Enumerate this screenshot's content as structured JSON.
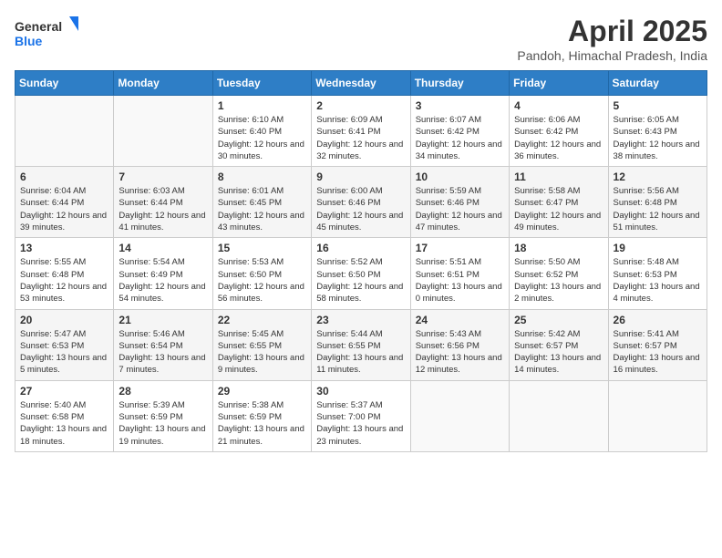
{
  "logo": {
    "line1": "General",
    "line2": "Blue"
  },
  "title": "April 2025",
  "location": "Pandoh, Himachal Pradesh, India",
  "weekdays": [
    "Sunday",
    "Monday",
    "Tuesday",
    "Wednesday",
    "Thursday",
    "Friday",
    "Saturday"
  ],
  "weeks": [
    [
      {
        "day": "",
        "info": ""
      },
      {
        "day": "",
        "info": ""
      },
      {
        "day": "1",
        "info": "Sunrise: 6:10 AM\nSunset: 6:40 PM\nDaylight: 12 hours and 30 minutes."
      },
      {
        "day": "2",
        "info": "Sunrise: 6:09 AM\nSunset: 6:41 PM\nDaylight: 12 hours and 32 minutes."
      },
      {
        "day": "3",
        "info": "Sunrise: 6:07 AM\nSunset: 6:42 PM\nDaylight: 12 hours and 34 minutes."
      },
      {
        "day": "4",
        "info": "Sunrise: 6:06 AM\nSunset: 6:42 PM\nDaylight: 12 hours and 36 minutes."
      },
      {
        "day": "5",
        "info": "Sunrise: 6:05 AM\nSunset: 6:43 PM\nDaylight: 12 hours and 38 minutes."
      }
    ],
    [
      {
        "day": "6",
        "info": "Sunrise: 6:04 AM\nSunset: 6:44 PM\nDaylight: 12 hours and 39 minutes."
      },
      {
        "day": "7",
        "info": "Sunrise: 6:03 AM\nSunset: 6:44 PM\nDaylight: 12 hours and 41 minutes."
      },
      {
        "day": "8",
        "info": "Sunrise: 6:01 AM\nSunset: 6:45 PM\nDaylight: 12 hours and 43 minutes."
      },
      {
        "day": "9",
        "info": "Sunrise: 6:00 AM\nSunset: 6:46 PM\nDaylight: 12 hours and 45 minutes."
      },
      {
        "day": "10",
        "info": "Sunrise: 5:59 AM\nSunset: 6:46 PM\nDaylight: 12 hours and 47 minutes."
      },
      {
        "day": "11",
        "info": "Sunrise: 5:58 AM\nSunset: 6:47 PM\nDaylight: 12 hours and 49 minutes."
      },
      {
        "day": "12",
        "info": "Sunrise: 5:56 AM\nSunset: 6:48 PM\nDaylight: 12 hours and 51 minutes."
      }
    ],
    [
      {
        "day": "13",
        "info": "Sunrise: 5:55 AM\nSunset: 6:48 PM\nDaylight: 12 hours and 53 minutes."
      },
      {
        "day": "14",
        "info": "Sunrise: 5:54 AM\nSunset: 6:49 PM\nDaylight: 12 hours and 54 minutes."
      },
      {
        "day": "15",
        "info": "Sunrise: 5:53 AM\nSunset: 6:50 PM\nDaylight: 12 hours and 56 minutes."
      },
      {
        "day": "16",
        "info": "Sunrise: 5:52 AM\nSunset: 6:50 PM\nDaylight: 12 hours and 58 minutes."
      },
      {
        "day": "17",
        "info": "Sunrise: 5:51 AM\nSunset: 6:51 PM\nDaylight: 13 hours and 0 minutes."
      },
      {
        "day": "18",
        "info": "Sunrise: 5:50 AM\nSunset: 6:52 PM\nDaylight: 13 hours and 2 minutes."
      },
      {
        "day": "19",
        "info": "Sunrise: 5:48 AM\nSunset: 6:53 PM\nDaylight: 13 hours and 4 minutes."
      }
    ],
    [
      {
        "day": "20",
        "info": "Sunrise: 5:47 AM\nSunset: 6:53 PM\nDaylight: 13 hours and 5 minutes."
      },
      {
        "day": "21",
        "info": "Sunrise: 5:46 AM\nSunset: 6:54 PM\nDaylight: 13 hours and 7 minutes."
      },
      {
        "day": "22",
        "info": "Sunrise: 5:45 AM\nSunset: 6:55 PM\nDaylight: 13 hours and 9 minutes."
      },
      {
        "day": "23",
        "info": "Sunrise: 5:44 AM\nSunset: 6:55 PM\nDaylight: 13 hours and 11 minutes."
      },
      {
        "day": "24",
        "info": "Sunrise: 5:43 AM\nSunset: 6:56 PM\nDaylight: 13 hours and 12 minutes."
      },
      {
        "day": "25",
        "info": "Sunrise: 5:42 AM\nSunset: 6:57 PM\nDaylight: 13 hours and 14 minutes."
      },
      {
        "day": "26",
        "info": "Sunrise: 5:41 AM\nSunset: 6:57 PM\nDaylight: 13 hours and 16 minutes."
      }
    ],
    [
      {
        "day": "27",
        "info": "Sunrise: 5:40 AM\nSunset: 6:58 PM\nDaylight: 13 hours and 18 minutes."
      },
      {
        "day": "28",
        "info": "Sunrise: 5:39 AM\nSunset: 6:59 PM\nDaylight: 13 hours and 19 minutes."
      },
      {
        "day": "29",
        "info": "Sunrise: 5:38 AM\nSunset: 6:59 PM\nDaylight: 13 hours and 21 minutes."
      },
      {
        "day": "30",
        "info": "Sunrise: 5:37 AM\nSunset: 7:00 PM\nDaylight: 13 hours and 23 minutes."
      },
      {
        "day": "",
        "info": ""
      },
      {
        "day": "",
        "info": ""
      },
      {
        "day": "",
        "info": ""
      }
    ]
  ]
}
